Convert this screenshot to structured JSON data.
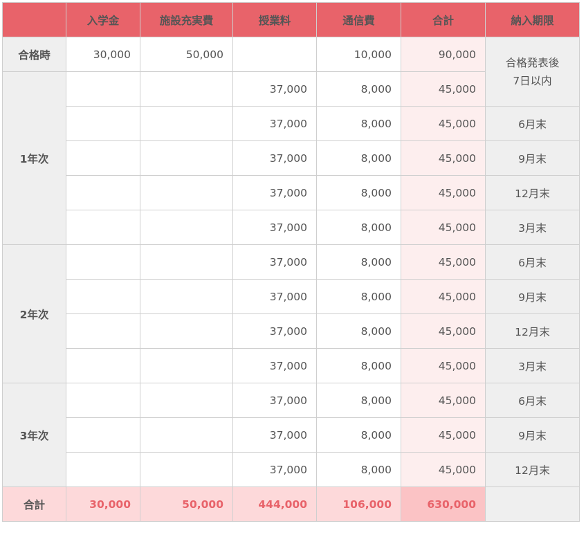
{
  "headers": [
    "",
    "入学金",
    "施設充実費",
    "授業料",
    "通信費",
    "合計",
    "納入期限"
  ],
  "admission": {
    "label": "合格時",
    "entrance": "30,000",
    "facility": "50,000",
    "tuition": "",
    "comm": "10,000",
    "total": "90,000",
    "due_line1": "合格発表後",
    "due_line2": "7日以内"
  },
  "years": [
    {
      "label": "1年次",
      "rows": [
        {
          "tuition": "37,000",
          "comm": "8,000",
          "total": "45,000",
          "due": ""
        },
        {
          "tuition": "37,000",
          "comm": "8,000",
          "total": "45,000",
          "due": "6月末"
        },
        {
          "tuition": "37,000",
          "comm": "8,000",
          "total": "45,000",
          "due": "9月末"
        },
        {
          "tuition": "37,000",
          "comm": "8,000",
          "total": "45,000",
          "due": "12月末"
        },
        {
          "tuition": "37,000",
          "comm": "8,000",
          "total": "45,000",
          "due": "3月末"
        }
      ]
    },
    {
      "label": "2年次",
      "rows": [
        {
          "tuition": "37,000",
          "comm": "8,000",
          "total": "45,000",
          "due": "6月末"
        },
        {
          "tuition": "37,000",
          "comm": "8,000",
          "total": "45,000",
          "due": "9月末"
        },
        {
          "tuition": "37,000",
          "comm": "8,000",
          "total": "45,000",
          "due": "12月末"
        },
        {
          "tuition": "37,000",
          "comm": "8,000",
          "total": "45,000",
          "due": "3月末"
        }
      ]
    },
    {
      "label": "3年次",
      "rows": [
        {
          "tuition": "37,000",
          "comm": "8,000",
          "total": "45,000",
          "due": "6月末"
        },
        {
          "tuition": "37,000",
          "comm": "8,000",
          "total": "45,000",
          "due": "9月末"
        },
        {
          "tuition": "37,000",
          "comm": "8,000",
          "total": "45,000",
          "due": "12月末"
        }
      ]
    }
  ],
  "totals": {
    "label": "合計",
    "entrance": "30,000",
    "facility": "50,000",
    "tuition": "444,000",
    "comm": "106,000",
    "total": "630,000"
  },
  "colors": {
    "header_bg": "#e8636a",
    "row_header_bg": "#efefef",
    "sum_col_bg": "#fdeeee",
    "total_row_bg": "#fdd9da",
    "total_text": "#e8636a"
  }
}
